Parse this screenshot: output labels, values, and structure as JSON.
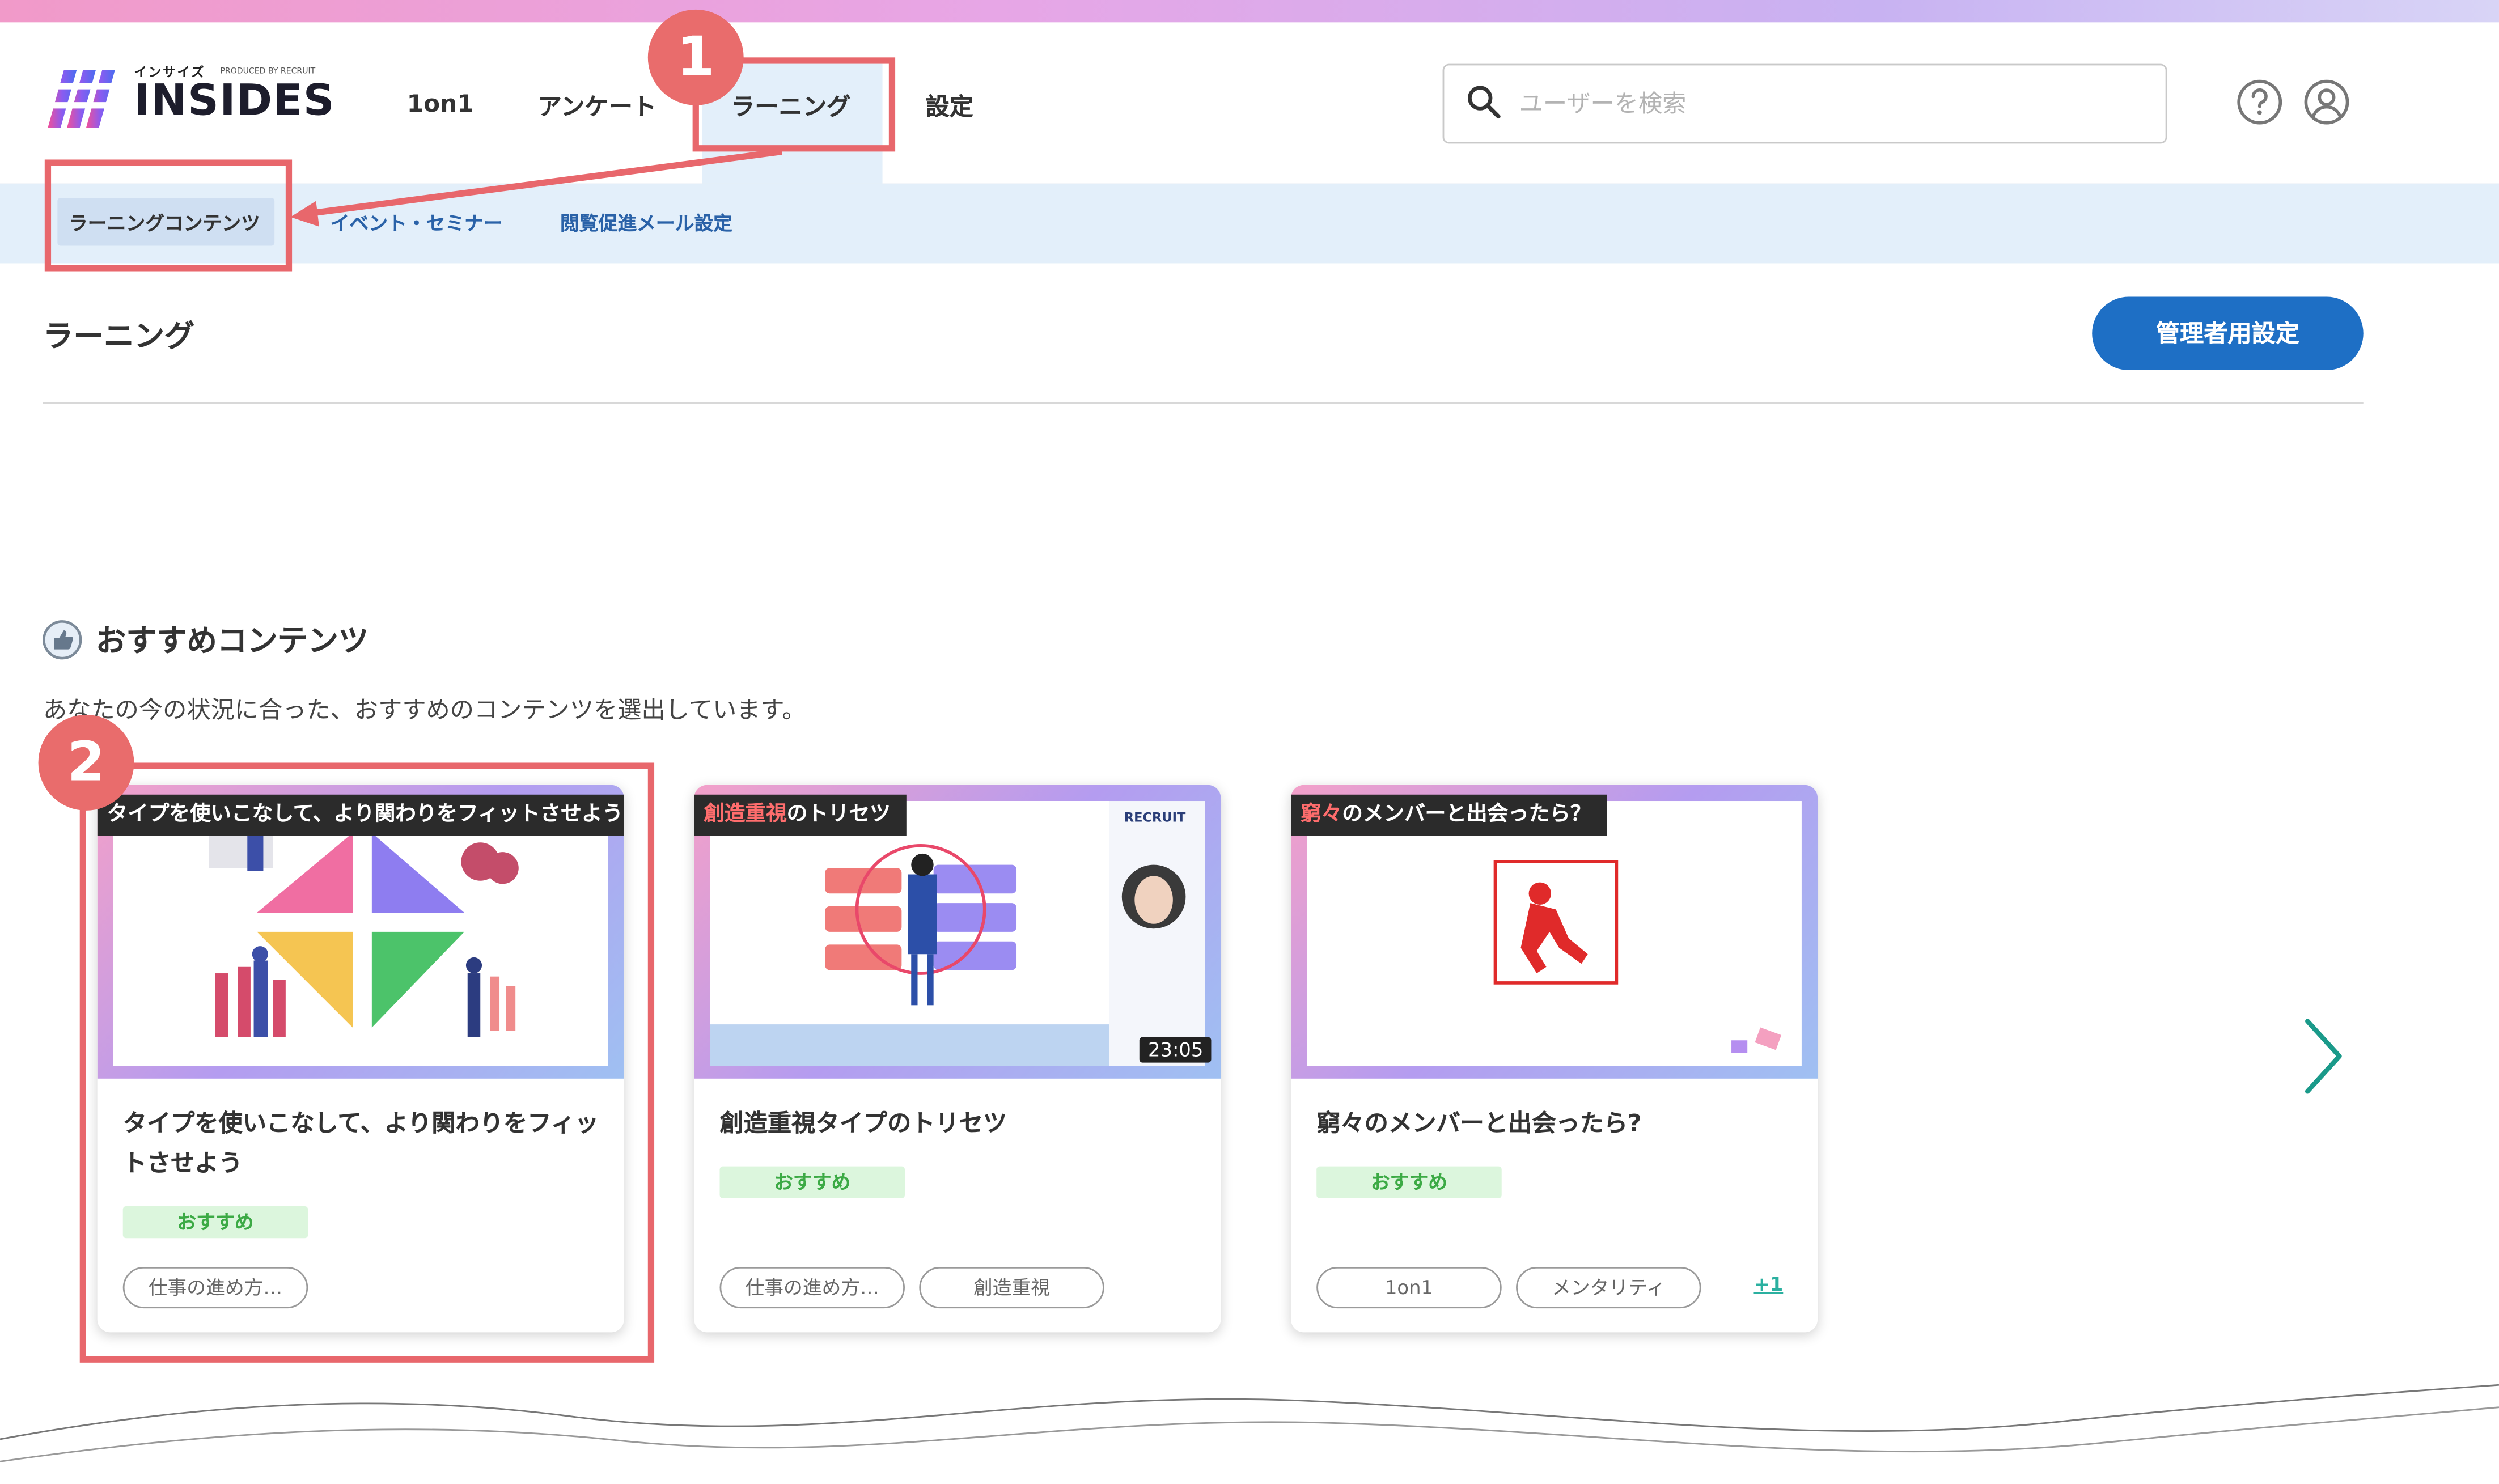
{
  "app": {
    "logo_kana": "インサイズ",
    "logo_produced_by": "PRODUCED BY RECRUIT",
    "logo_text": "INSIDES"
  },
  "nav": {
    "items": [
      "1on1",
      "アンケート",
      "ラーニング",
      "設定"
    ],
    "active": "ラーニング"
  },
  "subnav": {
    "items": [
      "ラーニングコンテンツ",
      "イベント・セミナー",
      "閲覧促進メール設定"
    ],
    "active": "ラーニングコンテンツ"
  },
  "search": {
    "placeholder": "ユーザーを検索"
  },
  "page": {
    "title": "ラーニング",
    "admin_button": "管理者用設定"
  },
  "recommended": {
    "title": "おすすめコンテンツ",
    "description": "あなたの今の状況に合った、おすすめのコンテンツを選出しています。",
    "cards": [
      {
        "thumb_label": "タイプを使いこなして、より関わりをフィットさせよう",
        "title": "タイプを使いこなして、より関わりをフィットさせよう",
        "badge": "おすすめ",
        "tags": [
          "仕事の進め方…"
        ]
      },
      {
        "thumb_label_hl": "創造重視",
        "thumb_label_rest": "のトリセツ",
        "thumb_logo": "RECRUIT",
        "duration": "23:05",
        "title": "創造重視タイプのトリセツ",
        "badge": "おすすめ",
        "tags": [
          "仕事の進め方…",
          "創造重視"
        ]
      },
      {
        "thumb_label_hl": "窮々",
        "thumb_label_rest": "のメンバーと出会ったら？",
        "title": "窮々のメンバーと出会ったら?",
        "badge": "おすすめ",
        "tags": [
          "1on1",
          "メンタリティ"
        ],
        "more": "+1"
      }
    ]
  },
  "annotations": {
    "step1": "1",
    "step2": "2"
  },
  "colors": {
    "accent": "#1e6fc5",
    "highlight": "#e8676c",
    "subnav_bg": "#e3effa",
    "badge_bg": "#dcf6dd",
    "badge_text": "#3caa45"
  }
}
